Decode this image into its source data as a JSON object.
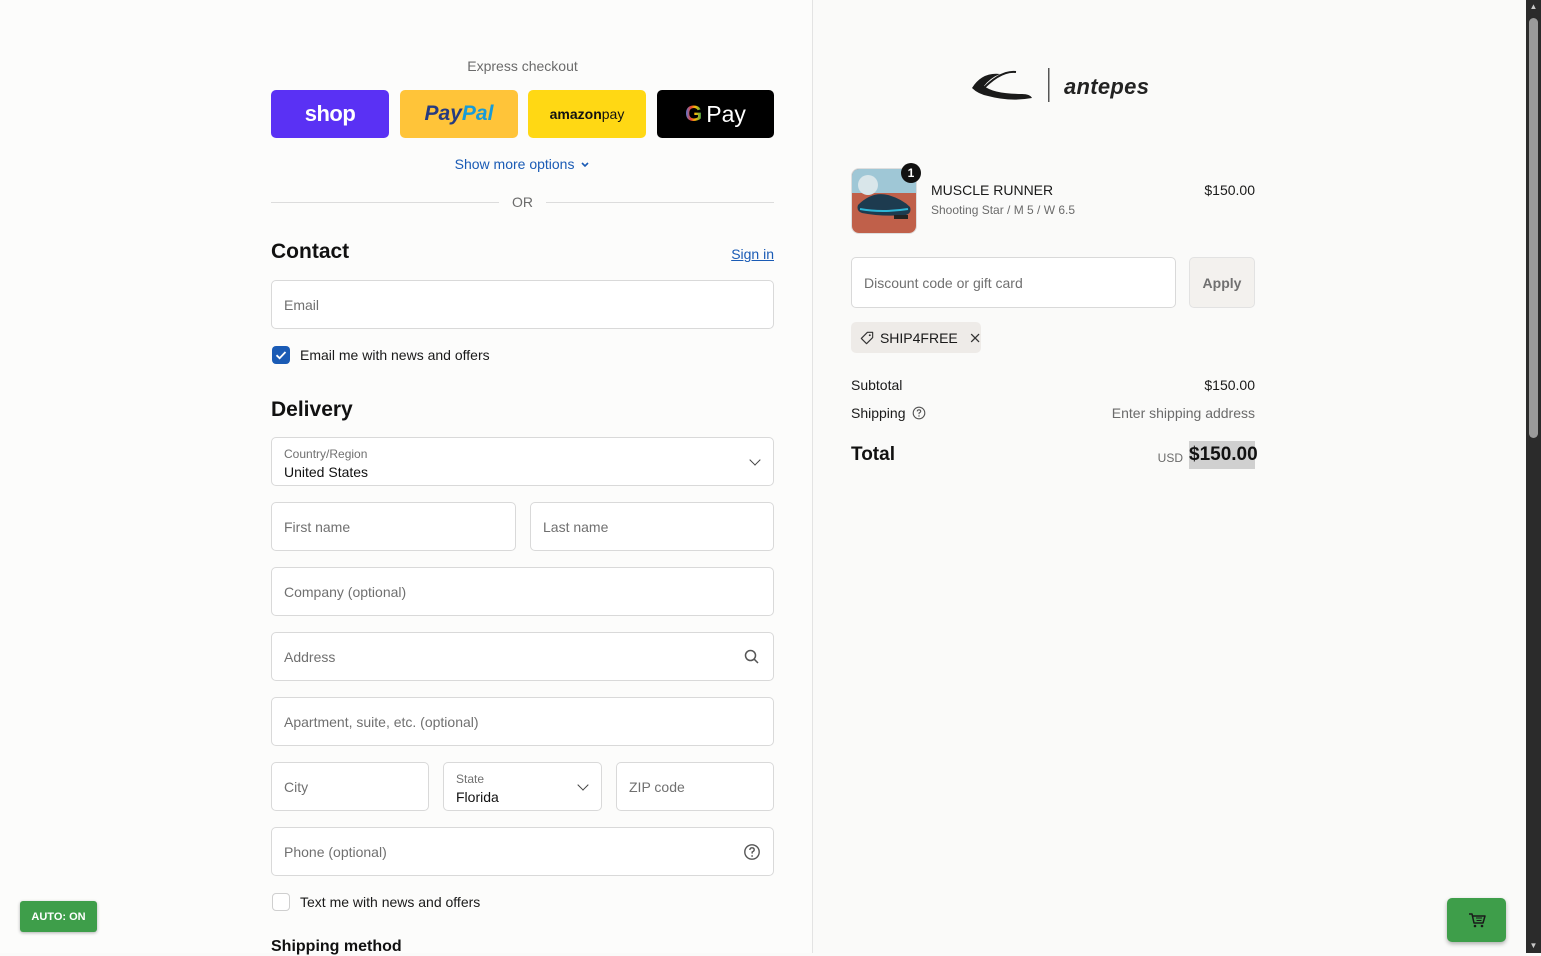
{
  "express": {
    "title": "Express checkout",
    "shop_label": "shop",
    "paypal_label_a": "Pay",
    "paypal_label_b": "Pal",
    "amazon_label_a": "amazon",
    "amazon_label_b": " pay",
    "gpay_label_g": "G",
    "gpay_label": "Pay",
    "show_more": "Show more options",
    "or": "OR"
  },
  "contact": {
    "heading": "Contact",
    "signin": "Sign in",
    "email_placeholder": "Email",
    "news_checkbox_label": "Email me with news and offers",
    "news_checked": true
  },
  "delivery": {
    "heading": "Delivery",
    "country_label": "Country/Region",
    "country_value": "United States",
    "first_name": "First name",
    "last_name": "Last name",
    "company": "Company (optional)",
    "address": "Address",
    "apartment": "Apartment, suite, etc. (optional)",
    "city": "City",
    "state_label": "State",
    "state_value": "Florida",
    "zip": "ZIP code",
    "phone": "Phone (optional)",
    "sms_checkbox_label": "Text me with news and offers",
    "sms_checked": false
  },
  "shipping_method": {
    "heading": "Shipping method"
  },
  "brand": {
    "name": "antepes"
  },
  "cart": {
    "item": {
      "quantity": "1",
      "name": "MUSCLE RUNNER",
      "variant": "Shooting Star / M 5 / W 6.5",
      "price": "$150.00"
    },
    "discount_placeholder": "Discount code or gift card",
    "apply_label": "Apply",
    "applied_code": "SHIP4FREE",
    "subtotal_label": "Subtotal",
    "subtotal_value": "$150.00",
    "shipping_label": "Shipping",
    "shipping_value": "Enter shipping address",
    "total_label": "Total",
    "total_currency": "USD",
    "total_value": "$150.00"
  },
  "widgets": {
    "auto_label": "AUTO: ON"
  },
  "colors": {
    "accent_blue": "#1a5bb5",
    "shop_purple": "#5a31f4",
    "paypal_yellow": "#ffc439",
    "amazon_yellow": "#ffd814",
    "widget_green": "#3e9e4a"
  },
  "icons": [
    "chevron-down-icon",
    "search-icon",
    "help-circle-icon",
    "tag-icon",
    "close-icon",
    "cart-icon",
    "check-icon"
  ]
}
